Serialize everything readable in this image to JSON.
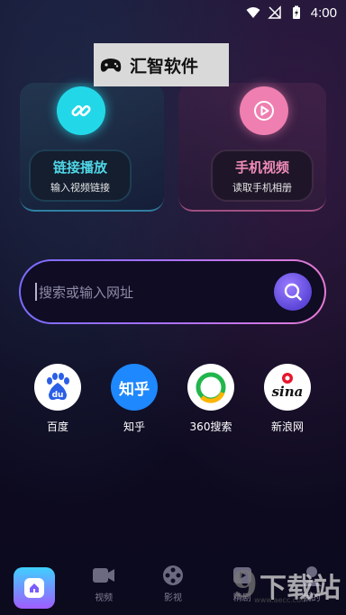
{
  "status_bar": {
    "time": "4:00"
  },
  "badge": {
    "title": "汇智软件"
  },
  "cards": [
    {
      "title": "链接播放",
      "subtitle": "输入视频链接",
      "icon": "link-icon",
      "accent": "#22d8e8"
    },
    {
      "title": "手机视频",
      "subtitle": "读取手机相册",
      "icon": "play-icon",
      "accent": "#ef7fb0"
    }
  ],
  "search": {
    "placeholder": "搜索或输入网址"
  },
  "sites": [
    {
      "label": "百度",
      "icon": "baidu-logo"
    },
    {
      "label": "知乎",
      "icon": "zhihu-logo",
      "logo_text": "知乎"
    },
    {
      "label": "360搜索",
      "icon": "360-logo"
    },
    {
      "label": "新浪网",
      "icon": "sina-logo"
    }
  ],
  "nav": [
    {
      "label": "",
      "icon": "home-icon",
      "active": true
    },
    {
      "label": "视频",
      "icon": "video-icon"
    },
    {
      "label": "影视",
      "icon": "film-reel-icon"
    },
    {
      "label": "精剧",
      "icon": "drama-icon"
    },
    {
      "label": "我的",
      "icon": "profile-icon"
    }
  ],
  "watermark": {
    "text": "下载站",
    "prefix": "9",
    "url": "www.aecc.com"
  }
}
